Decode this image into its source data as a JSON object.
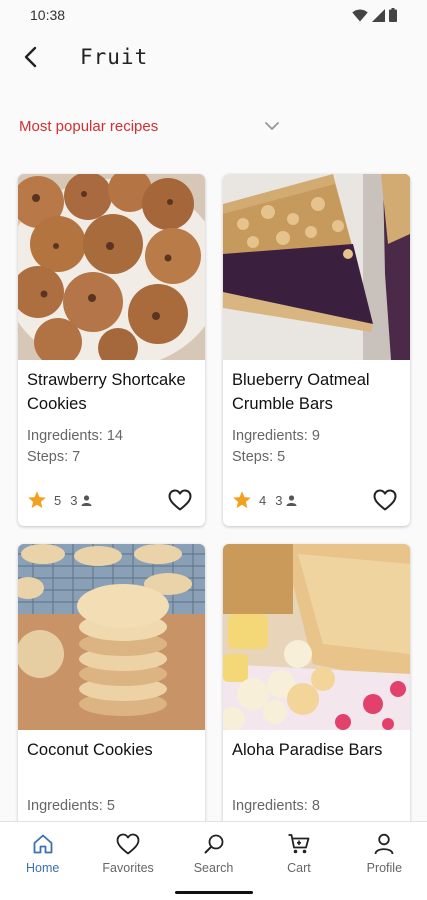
{
  "status": {
    "time": "10:38"
  },
  "header": {
    "title": "Fruit"
  },
  "sort": {
    "label": "Most popular recipes"
  },
  "recipes": [
    {
      "title": "Strawberry Shortcake Cookies",
      "ingredients_label": "Ingredients:",
      "ingredients": "14",
      "steps_label": "Steps:",
      "steps": "7",
      "rating": "5",
      "rating_count": "3"
    },
    {
      "title": "Blueberry Oatmeal Crumble Bars",
      "ingredients_label": "Ingredients:",
      "ingredients": "9",
      "steps_label": "Steps:",
      "steps": "5",
      "rating": "4",
      "rating_count": "3"
    },
    {
      "title": "Coconut Cookies",
      "ingredients_label": "Ingredients:",
      "ingredients": "5"
    },
    {
      "title": "Aloha Paradise Bars",
      "ingredients_label": "Ingredients:",
      "ingredients": "8"
    }
  ],
  "nav": {
    "items": [
      {
        "label": "Home",
        "icon": "home-icon",
        "active": true
      },
      {
        "label": "Favorites",
        "icon": "heart-icon"
      },
      {
        "label": "Search",
        "icon": "search-icon"
      },
      {
        "label": "Cart",
        "icon": "cart-icon"
      },
      {
        "label": "Profile",
        "icon": "person-icon"
      }
    ]
  },
  "colors": {
    "accent": "#d32f2f",
    "nav_active": "#3b6fb6",
    "star": "#f2a01e"
  }
}
